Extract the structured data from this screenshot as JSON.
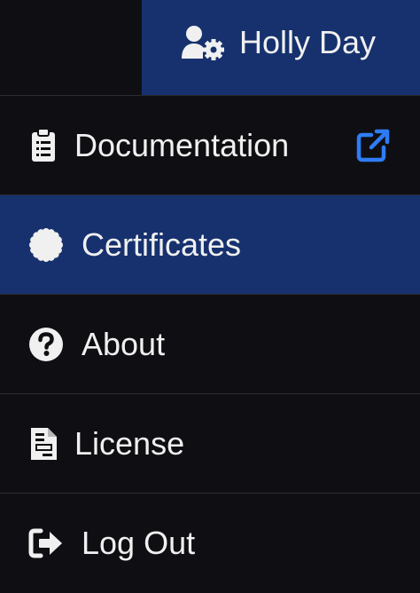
{
  "user": {
    "name": "Holly Day",
    "icon": "user-gear-icon"
  },
  "menu": {
    "items": [
      {
        "label": "Documentation",
        "icon": "clipboard-list-icon",
        "external_icon": "external-link-icon"
      },
      {
        "label": "Certificates",
        "icon": "certificate-icon",
        "active": true
      },
      {
        "label": "About",
        "icon": "question-circle-icon"
      },
      {
        "label": "License",
        "icon": "file-text-icon"
      },
      {
        "label": "Log Out",
        "icon": "sign-out-icon"
      }
    ]
  },
  "colors": {
    "background": "#0f0f13",
    "active": "#16316e",
    "text": "#f0f0f0",
    "divider": "#2a2b31",
    "link_accent": "#2f7cf6"
  }
}
